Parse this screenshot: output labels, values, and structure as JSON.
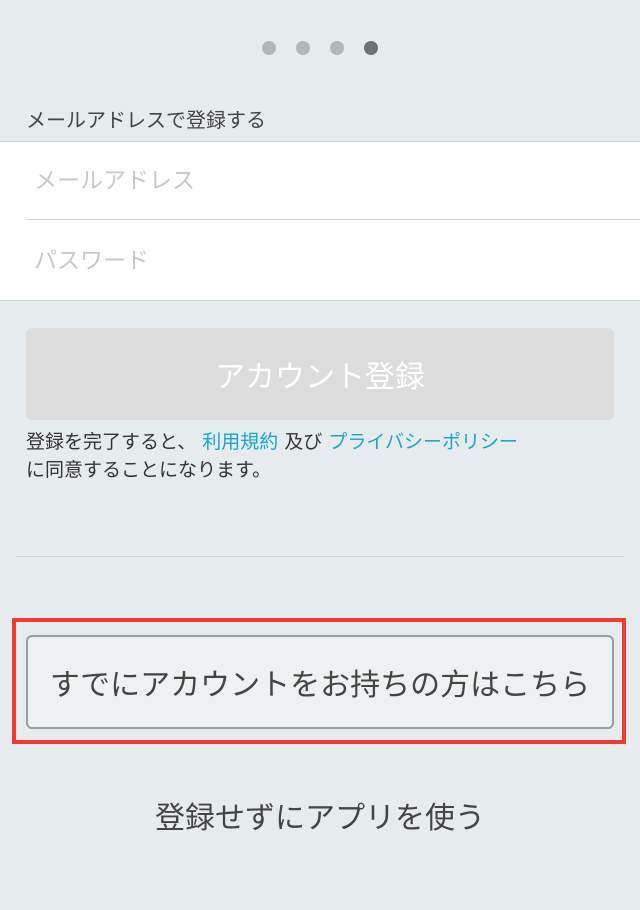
{
  "pagination": {
    "total": 4,
    "active_index": 3
  },
  "signup": {
    "section_label": "メールアドレスで登録する",
    "email_placeholder": "メールアドレス",
    "password_placeholder": "パスワード",
    "register_label": "アカウント登録"
  },
  "terms": {
    "prefix": "登録を完了すると、",
    "terms_link": "利用規約",
    "and": "及び",
    "privacy_link": "プライバシーポリシー",
    "suffix": "に同意することになります。"
  },
  "actions": {
    "login_label": "すでにアカウントをお持ちの方はこちら",
    "skip_label": "登録せずにアプリを使う"
  },
  "colors": {
    "background": "#e6ecee",
    "link": "#1aa5c9",
    "highlight": "#f23a2f",
    "dot_inactive": "#b3b6b8",
    "dot_active": "#6f7274"
  }
}
